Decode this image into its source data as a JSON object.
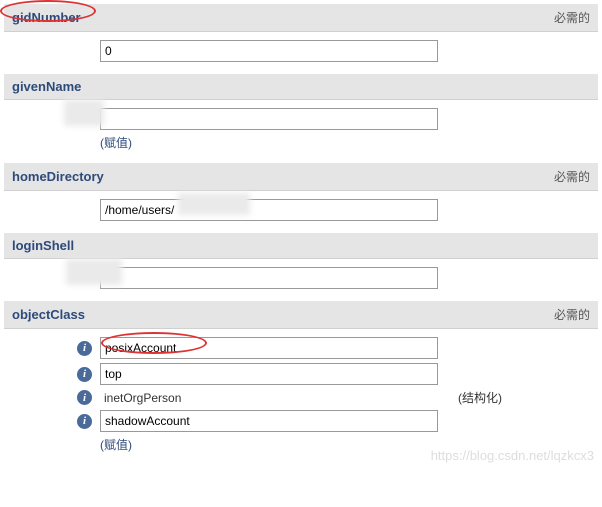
{
  "required_label": "必需的",
  "assign_link": "(赋值)",
  "structural_label": "(结构化)",
  "watermark": "https://blog.csdn.net/lqzkcx3",
  "fields": {
    "gidNumber": {
      "label": "gidNumber",
      "value": "0",
      "required": true
    },
    "givenName": {
      "label": "givenName",
      "value": ""
    },
    "homeDirectory": {
      "label": "homeDirectory",
      "value": "/home/users/",
      "required": true
    },
    "loginShell": {
      "label": "loginShell",
      "value": ""
    },
    "objectClass": {
      "label": "objectClass",
      "required": true,
      "values": {
        "v0": "posixAccount",
        "v1": "top",
        "v2": "inetOrgPerson",
        "v3": "shadowAccount"
      }
    }
  }
}
